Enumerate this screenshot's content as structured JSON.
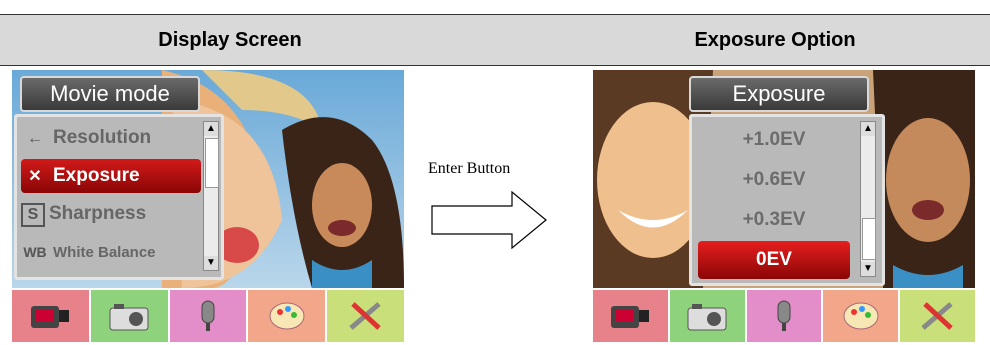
{
  "headers": {
    "left": "Display Screen",
    "right": "Exposure Option"
  },
  "arrow_label": "Enter Button",
  "left_screen": {
    "menu_title": "Movie mode",
    "items": [
      {
        "icon": "←",
        "label": "Resolution",
        "selected": false
      },
      {
        "icon": "✕",
        "label": "Exposure",
        "selected": true
      },
      {
        "icon": "S",
        "label": "Sharpness",
        "selected": false
      },
      {
        "icon": "WB",
        "label": "White Balance",
        "selected": false
      }
    ]
  },
  "right_screen": {
    "menu_title": "Exposure",
    "items": [
      {
        "label": "+1.0EV",
        "selected": false
      },
      {
        "label": "+0.6EV",
        "selected": false
      },
      {
        "label": "+0.3EV",
        "selected": false
      },
      {
        "label": "0EV",
        "selected": true
      }
    ]
  },
  "tabs": [
    {
      "icon": "camcorder-icon",
      "color": "#e8828a"
    },
    {
      "icon": "camera-icon",
      "color": "#8fd27c"
    },
    {
      "icon": "microphone-icon",
      "color": "#e38ec8"
    },
    {
      "icon": "palette-icon",
      "color": "#f2a78a"
    },
    {
      "icon": "tools-icon",
      "color": "#c9e07a"
    }
  ]
}
